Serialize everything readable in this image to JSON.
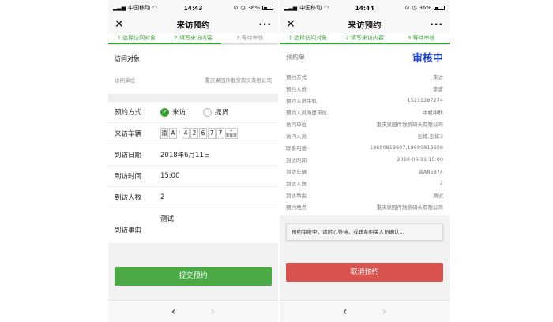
{
  "status_bar": {
    "carrier": "中国移动",
    "battery": "36%",
    "left_time": "14:43",
    "right_time": "14:44"
  },
  "nav": {
    "title": "来访预约",
    "close": "✕",
    "more": "···"
  },
  "steps": [
    {
      "label": "1.选择访问对象"
    },
    {
      "label": "2.填写来访内容"
    },
    {
      "label": "3.等待审核"
    }
  ],
  "left": {
    "section_title": "访问对象",
    "visit_unit_label": "访问单位",
    "visit_unit_value": "重庆果园件散货码头有限公司",
    "method_label": "预约方式",
    "method_option_1": "来访",
    "method_option_2": "提货",
    "vehicle_label": "来访车辆",
    "plate_chars": [
      "渝",
      "A",
      "4",
      "2",
      "6",
      "7",
      "7"
    ],
    "plate_new_energy": "新能源",
    "date_label": "到访日期",
    "date_value": "2018年6月11日",
    "time_label": "到访时间",
    "time_value": "15:00",
    "count_label": "到访人数",
    "count_value": "2",
    "reason_label": "到访事由",
    "reason_value": "测试",
    "submit": "提交预约"
  },
  "right": {
    "order_label": "预约单",
    "order_status": "审核中",
    "rows": [
      {
        "label": "预约方式",
        "value": "来访"
      },
      {
        "label": "预约人员",
        "value": "李波"
      },
      {
        "label": "预约人员手机",
        "value": "15215287274"
      },
      {
        "label": "预约人员所属单位",
        "value": "中机中联"
      },
      {
        "label": "访问单位",
        "value": "重庆果园件散货码头有限公司"
      },
      {
        "label": "访问人员",
        "value": "彭炼,彭炼3"
      },
      {
        "label": "联系电话",
        "value": "18680813607,18680813608"
      },
      {
        "label": "到访时间",
        "value": "2018-06-11 15:00"
      },
      {
        "label": "到访车辆",
        "value": "渝A85874"
      },
      {
        "label": "到访人数",
        "value": "2"
      },
      {
        "label": "到访事由",
        "value": "测试"
      },
      {
        "label": "预约地点",
        "value": "重庆果园件散货码头有限公司"
      }
    ],
    "notice": "预约审批中，请耐心等待，或联系相关人员确认...",
    "cancel": "取消预约"
  },
  "bottom": {
    "back": "‹",
    "forward": "›"
  },
  "colors": {
    "accent_green": "#4caa46",
    "status_blue": "#1a3cc8",
    "cancel_red": "#d9534f"
  }
}
